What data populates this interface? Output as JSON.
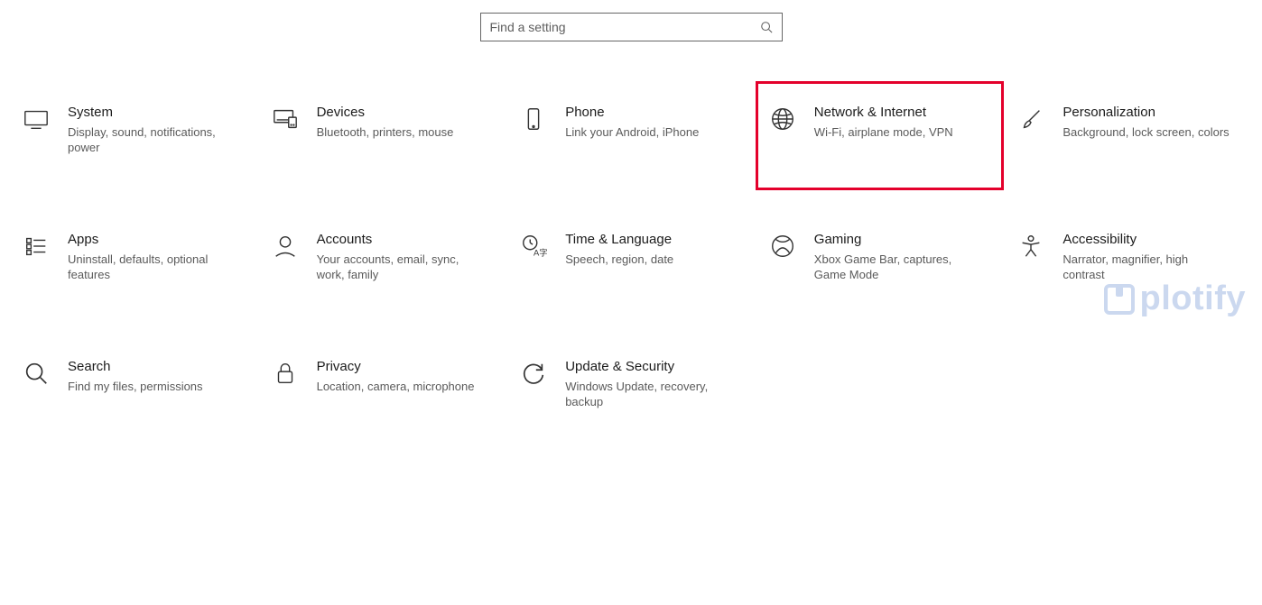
{
  "search": {
    "placeholder": "Find a setting"
  },
  "tiles": {
    "system": {
      "title": "System",
      "desc": "Display, sound, notifications, power"
    },
    "devices": {
      "title": "Devices",
      "desc": "Bluetooth, printers, mouse"
    },
    "phone": {
      "title": "Phone",
      "desc": "Link your Android, iPhone"
    },
    "network": {
      "title": "Network & Internet",
      "desc": "Wi-Fi, airplane mode, VPN"
    },
    "personalization": {
      "title": "Personalization",
      "desc": "Background, lock screen, colors"
    },
    "apps": {
      "title": "Apps",
      "desc": "Uninstall, defaults, optional features"
    },
    "accounts": {
      "title": "Accounts",
      "desc": "Your accounts, email, sync, work, family"
    },
    "time": {
      "title": "Time & Language",
      "desc": "Speech, region, date"
    },
    "gaming": {
      "title": "Gaming",
      "desc": "Xbox Game Bar, captures, Game Mode"
    },
    "accessibility": {
      "title": "Accessibility",
      "desc": "Narrator, magnifier, high contrast"
    },
    "search_tile": {
      "title": "Search",
      "desc": "Find my files, permissions"
    },
    "privacy": {
      "title": "Privacy",
      "desc": "Location, camera, microphone"
    },
    "update": {
      "title": "Update & Security",
      "desc": "Windows Update, recovery, backup"
    }
  },
  "watermark": "plotify"
}
